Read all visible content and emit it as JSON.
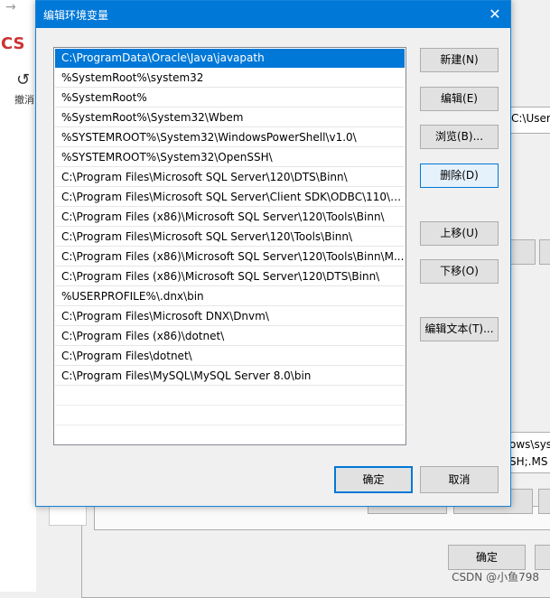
{
  "background": {
    "undo_label": "撤消",
    "cs_logo": "CS",
    "path_fragment_1": "C:\\Users",
    "path_fragment_2": "ows\\syst",
    "path_fragment_3": "SH;.MS",
    "ok_label": "确定",
    "watermark": "CSDN @小鱼798"
  },
  "dialog": {
    "title": "编辑环境变量",
    "close_glyph": "✕",
    "paths": [
      "C:\\ProgramData\\Oracle\\Java\\javapath",
      "%SystemRoot%\\system32",
      "%SystemRoot%",
      "%SystemRoot%\\System32\\Wbem",
      "%SYSTEMROOT%\\System32\\WindowsPowerShell\\v1.0\\",
      "%SYSTEMROOT%\\System32\\OpenSSH\\",
      "C:\\Program Files\\Microsoft SQL Server\\120\\DTS\\Binn\\",
      "C:\\Program Files\\Microsoft SQL Server\\Client SDK\\ODBC\\110\\T...",
      "C:\\Program Files (x86)\\Microsoft SQL Server\\120\\Tools\\Binn\\",
      "C:\\Program Files\\Microsoft SQL Server\\120\\Tools\\Binn\\",
      "C:\\Program Files (x86)\\Microsoft SQL Server\\120\\Tools\\Binn\\M...",
      "C:\\Program Files (x86)\\Microsoft SQL Server\\120\\DTS\\Binn\\",
      "%USERPROFILE%\\.dnx\\bin",
      "C:\\Program Files\\Microsoft DNX\\Dnvm\\",
      "C:\\Program Files (x86)\\dotnet\\",
      "C:\\Program Files\\dotnet\\",
      "C:\\Program Files\\MySQL\\MySQL Server 8.0\\bin"
    ],
    "selected_index": 0,
    "buttons": {
      "new": "新建(N)",
      "edit": "编辑(E)",
      "browse": "浏览(B)...",
      "delete": "删除(D)",
      "move_up": "上移(U)",
      "move_down": "下移(O)",
      "edit_text": "编辑文本(T)...",
      "ok": "确定",
      "cancel": "取消"
    },
    "colors": {
      "accent": "#0078d7",
      "selection": "#0078d7"
    }
  }
}
